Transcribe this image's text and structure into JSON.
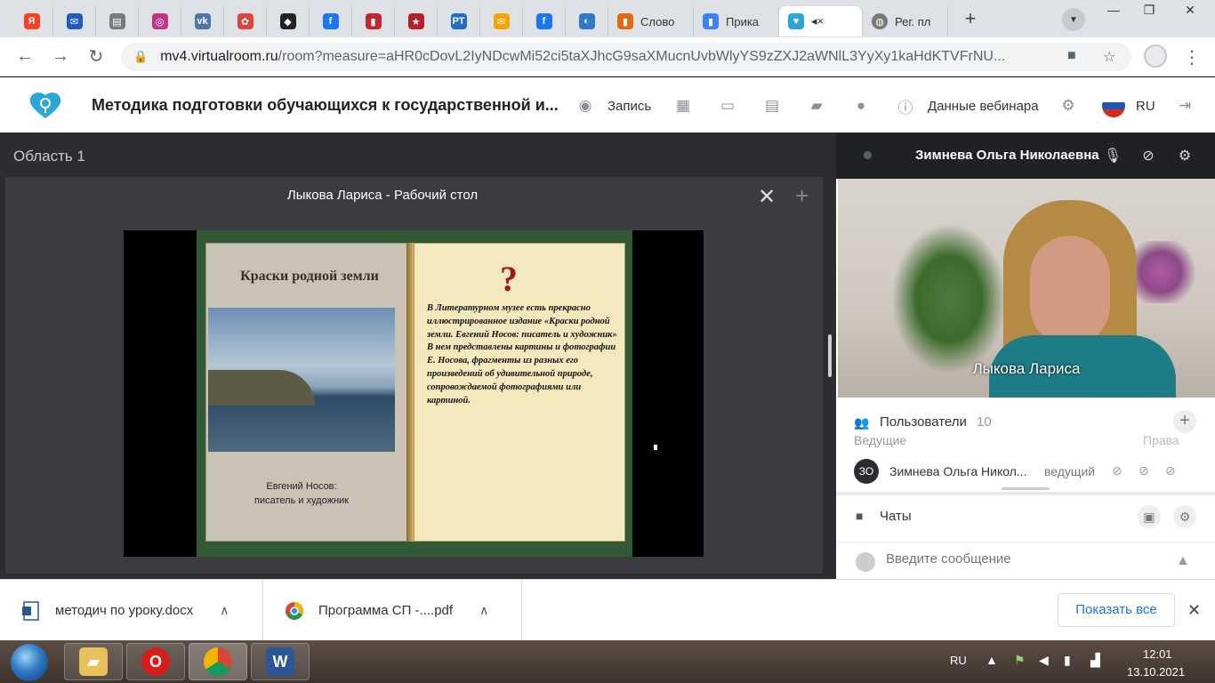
{
  "browser": {
    "tabs": [
      {
        "icon": "yandex-icon",
        "glyph": "Я",
        "color": "#fc3f1d"
      },
      {
        "icon": "mail-icon",
        "glyph": "✉",
        "color": "#1e5bbf"
      },
      {
        "icon": "document-icon",
        "glyph": "▤",
        "color": "#7a7a7a"
      },
      {
        "icon": "instagram-icon",
        "glyph": "◎",
        "color": "#c13584"
      },
      {
        "icon": "vk-icon",
        "glyph": "vk",
        "color": "#4a76a8"
      },
      {
        "icon": "flower-icon",
        "glyph": "✿",
        "color": "#e0433a"
      },
      {
        "icon": "app-icon",
        "glyph": "◆",
        "color": "#222222"
      },
      {
        "icon": "facebook-icon",
        "glyph": "f",
        "color": "#1877f2"
      },
      {
        "icon": "bookmark-icon",
        "glyph": "▮",
        "color": "#c4262e"
      },
      {
        "icon": "star-icon",
        "glyph": "★",
        "color": "#b5202b"
      },
      {
        "icon": "rt-icon",
        "glyph": "РТ",
        "color": "#1e6ec8"
      },
      {
        "icon": "mail-icon",
        "glyph": "✉",
        "color": "#f4a300"
      },
      {
        "icon": "facebook-icon",
        "glyph": "f",
        "color": "#1877f2"
      },
      {
        "icon": "chart-icon",
        "glyph": "◐",
        "color": "#3079c8"
      }
    ],
    "wide_tabs": [
      {
        "icon": "dictionary-icon",
        "label": "Слово",
        "color": "#e06a12"
      },
      {
        "icon": "order-icon",
        "label": "Прика",
        "color": "#3b82f6"
      }
    ],
    "active_tab": {
      "icon": "virtualroom-icon",
      "label": "◂×"
    },
    "last_tab": {
      "icon": "globe-icon",
      "label": "Рег. пл"
    },
    "url_host": "mv4.virtualroom.ru",
    "url_rest": "/room?measure=aHR0cDovL2IyNDcwMi52ci5taXJhcG9saXMucnUvbWlyYS9zZXJ2aWNlL3YyXy1kaHdKTVFrNU..."
  },
  "app": {
    "title": "Методика подготовки обучающихся к государственной и...",
    "record_label": "Запись",
    "webinar_data_label": "Данные вебинара",
    "lang": "RU"
  },
  "main": {
    "area_title": "Область 1",
    "screen_title": "Лыкова Лариса - Рабочий стол",
    "slide": {
      "book_title": "Краски родной земли",
      "author_line1": "Евгений Носов:",
      "author_line2": "писатель и художник",
      "question": "?",
      "text": "В Литературном музее есть прекрасно иллюстрированное издание «Краски родной земли. Евгений Носов: писатель и художник» В нем представлены картины и фотографии    Е. Носова, фрагменты из разных его произведений об удивительной природе, сопровождаемой  фотографиями или картиной."
    }
  },
  "right": {
    "presenter_name": "Зимнева Ольга Николаевна",
    "camera_name": "Лыкова Лариса",
    "users_label": "Пользователи",
    "users_count": "10",
    "col_host": "Ведущие",
    "col_rights": "Права",
    "user": {
      "initials": "ЗО",
      "name": "Зимнева Ольга Никол...",
      "role": "ведущий"
    },
    "chats_label": "Чаты",
    "message_placeholder": "Введите сообщение"
  },
  "downloads": {
    "items": [
      {
        "icon": "word-doc-icon",
        "name": "методич по уроку.docx"
      },
      {
        "icon": "chrome-pdf-icon",
        "name": "Программа СП -....pdf"
      }
    ],
    "show_all": "Показать все"
  },
  "taskbar": {
    "lang": "RU",
    "time": "12:01",
    "date": "13.10.2021"
  }
}
